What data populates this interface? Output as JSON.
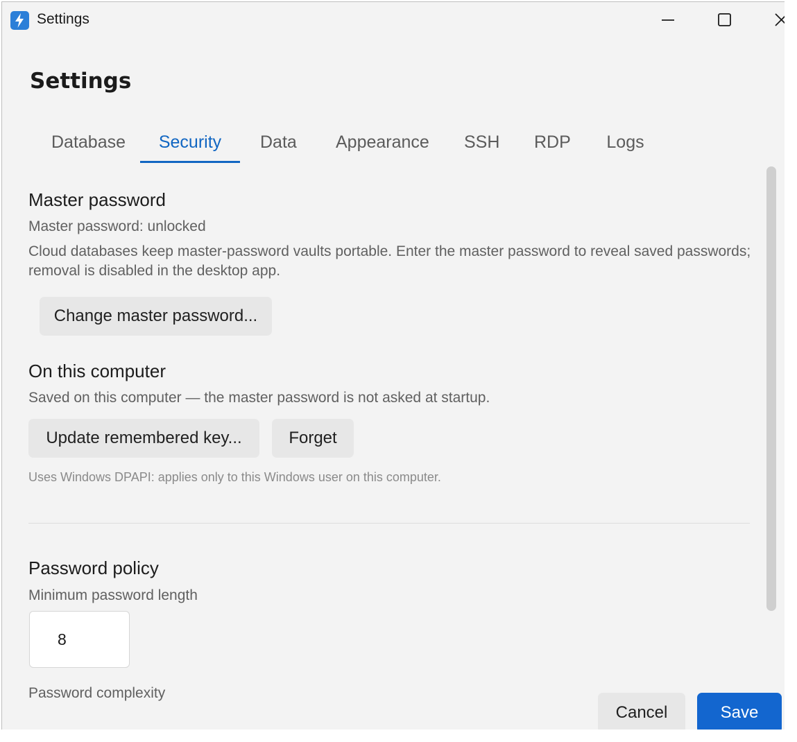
{
  "window": {
    "title": "Settings",
    "accent_color": "#1166c2",
    "icons": {
      "app": "lightning-bolt-icon",
      "minimize": "minimize-icon",
      "maximize": "maximize-icon",
      "close": "close-icon"
    }
  },
  "page_title": "Settings",
  "tabs": [
    {
      "label": "Database",
      "active": false
    },
    {
      "label": "Security",
      "active": true
    },
    {
      "label": "Data",
      "active": false
    },
    {
      "label": "Appearance",
      "active": false
    },
    {
      "label": "SSH",
      "active": false
    },
    {
      "label": "RDP",
      "active": false
    },
    {
      "label": "Logs",
      "active": false
    }
  ],
  "master_password": {
    "heading": "Master password",
    "status": "Master password: unlocked",
    "description_line1": "Cloud databases keep master-password vaults portable. Enter the master password to reveal saved passwords;",
    "description_line2": "removal is disabled in the desktop app.",
    "change_button": "Change master password..."
  },
  "on_this_computer": {
    "heading": "On this computer",
    "status": "Saved on this computer — the master password is not asked at startup.",
    "update_button": "Update remembered key...",
    "forget_button": "Forget",
    "note": "Uses Windows DPAPI: applies only to this Windows user on this computer."
  },
  "password_policy": {
    "heading": "Password policy",
    "min_length_label": "Minimum password length",
    "min_length_value": "8",
    "complexity_label": "Password complexity"
  },
  "footer": {
    "cancel": "Cancel",
    "save": "Save",
    "save_color": "#1366cf"
  }
}
